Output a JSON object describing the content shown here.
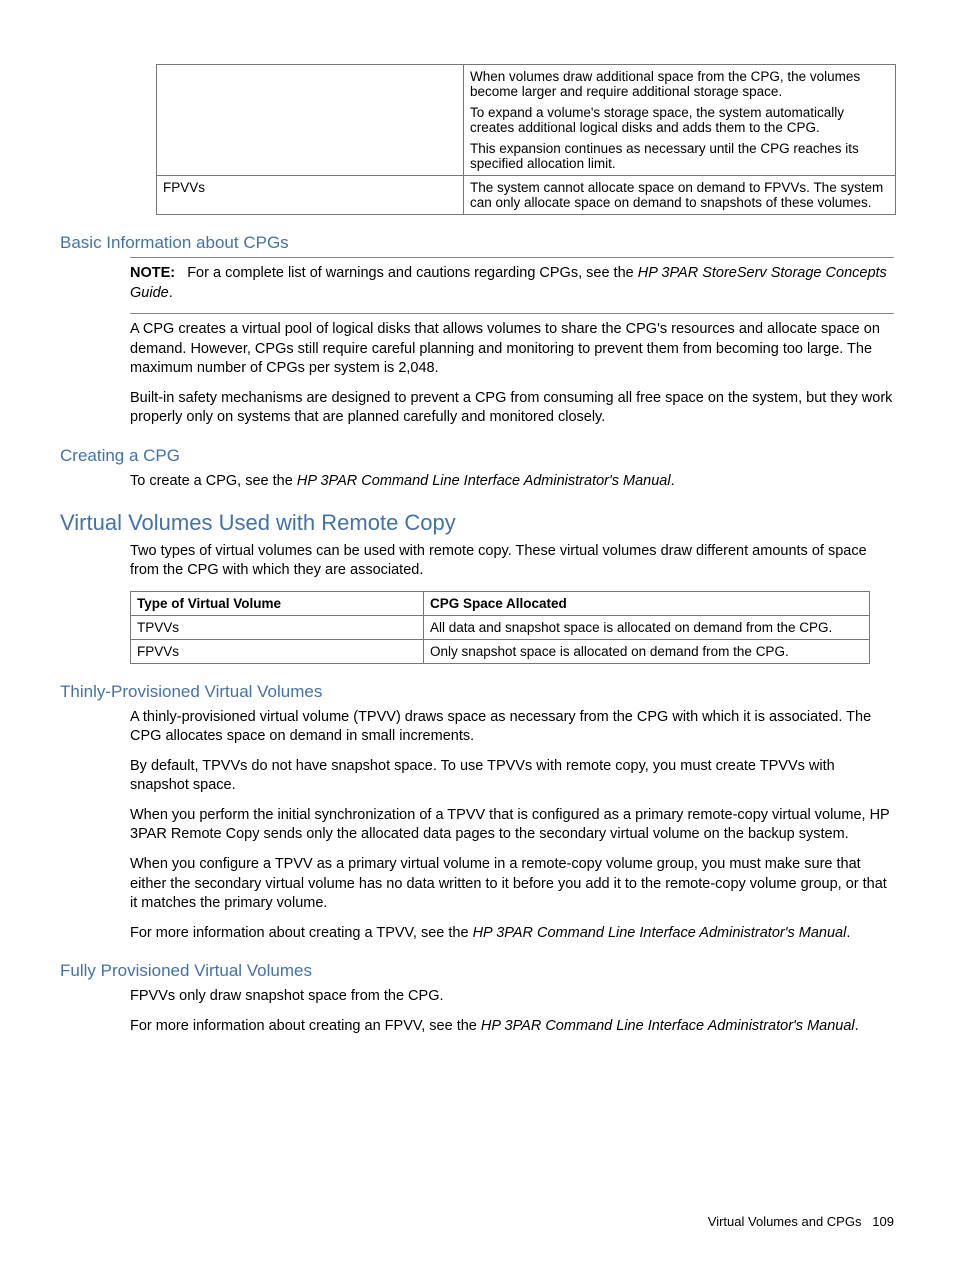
{
  "topTable": {
    "row1": {
      "col1": "",
      "p1": "When volumes draw additional space from the CPG, the volumes become larger and require additional storage space.",
      "p2": "To expand a volume's storage space, the system automatically creates additional logical disks and adds them to the CPG.",
      "p3": "This expansion continues as necessary until the CPG reaches its specified allocation limit."
    },
    "row2": {
      "col1": "FPVVs",
      "col2": "The system cannot allocate space on demand to FPVVs. The system can only allocate space on demand to snapshots of these volumes."
    }
  },
  "basicInfo": {
    "heading": "Basic Information about CPGs",
    "noteLabel": "NOTE:",
    "notePre": "For a complete list of warnings and cautions regarding CPGs, see the ",
    "noteItalic": "HP 3PAR StoreServ Storage Concepts Guide",
    "notePost": ".",
    "p1": "A CPG creates a virtual pool of logical disks that allows volumes to share the CPG's resources and allocate space on demand. However, CPGs still require careful planning and monitoring to prevent them from becoming too large. The maximum number of CPGs per system is 2,048.",
    "p2": "Built-in safety mechanisms are designed to prevent a CPG from consuming all free space on the system, but they work properly only on systems that are planned carefully and monitored closely."
  },
  "creatingCPG": {
    "heading": "Creating a CPG",
    "pPre": "To create a CPG, see the ",
    "pItalic": "HP 3PAR Command Line Interface Administrator's Manual",
    "pPost": "."
  },
  "virtualVolumes": {
    "heading": "Virtual Volumes Used with Remote Copy",
    "intro": "Two types of virtual volumes can be used with remote copy. These virtual volumes draw different amounts of space from the CPG with which they are associated.",
    "table": {
      "h1": "Type of Virtual Volume",
      "h2": "CPG Space Allocated",
      "r1c1": "TPVVs",
      "r1c2": "All data and snapshot space is allocated on demand from the CPG.",
      "r2c1": "FPVVs",
      "r2c2": "Only snapshot space is allocated on demand from the CPG."
    }
  },
  "tpvv": {
    "heading": "Thinly-Provisioned Virtual Volumes",
    "p1": "A thinly-provisioned virtual volume (TPVV) draws space as necessary from the CPG with which it is associated. The CPG allocates space on demand in small increments.",
    "p2": "By default, TPVVs do not have snapshot space. To use TPVVs with remote copy, you must create TPVVs with snapshot space.",
    "p3": "When you perform the initial synchronization of a TPVV that is configured as a primary remote-copy virtual volume, HP 3PAR Remote Copy sends only the allocated data pages to the secondary virtual volume on the backup system.",
    "p4": "When you configure a TPVV as a primary virtual volume in a remote-copy volume group, you must make sure that either the secondary virtual volume has no data written to it before you add it to the remote-copy volume group, or that it matches the primary volume.",
    "p5pre": "For more information about creating a TPVV, see the ",
    "p5italic": "HP 3PAR Command Line Interface Administrator's Manual",
    "p5post": "."
  },
  "fpvv": {
    "heading": "Fully Provisioned Virtual Volumes",
    "p1": "FPVVs only draw snapshot space from the CPG.",
    "p2pre": "For more information about creating an FPVV, see the ",
    "p2italic": "HP 3PAR Command Line Interface Administrator's Manual",
    "p2post": "."
  },
  "footer": {
    "text": "Virtual Volumes and CPGs",
    "page": "109"
  }
}
